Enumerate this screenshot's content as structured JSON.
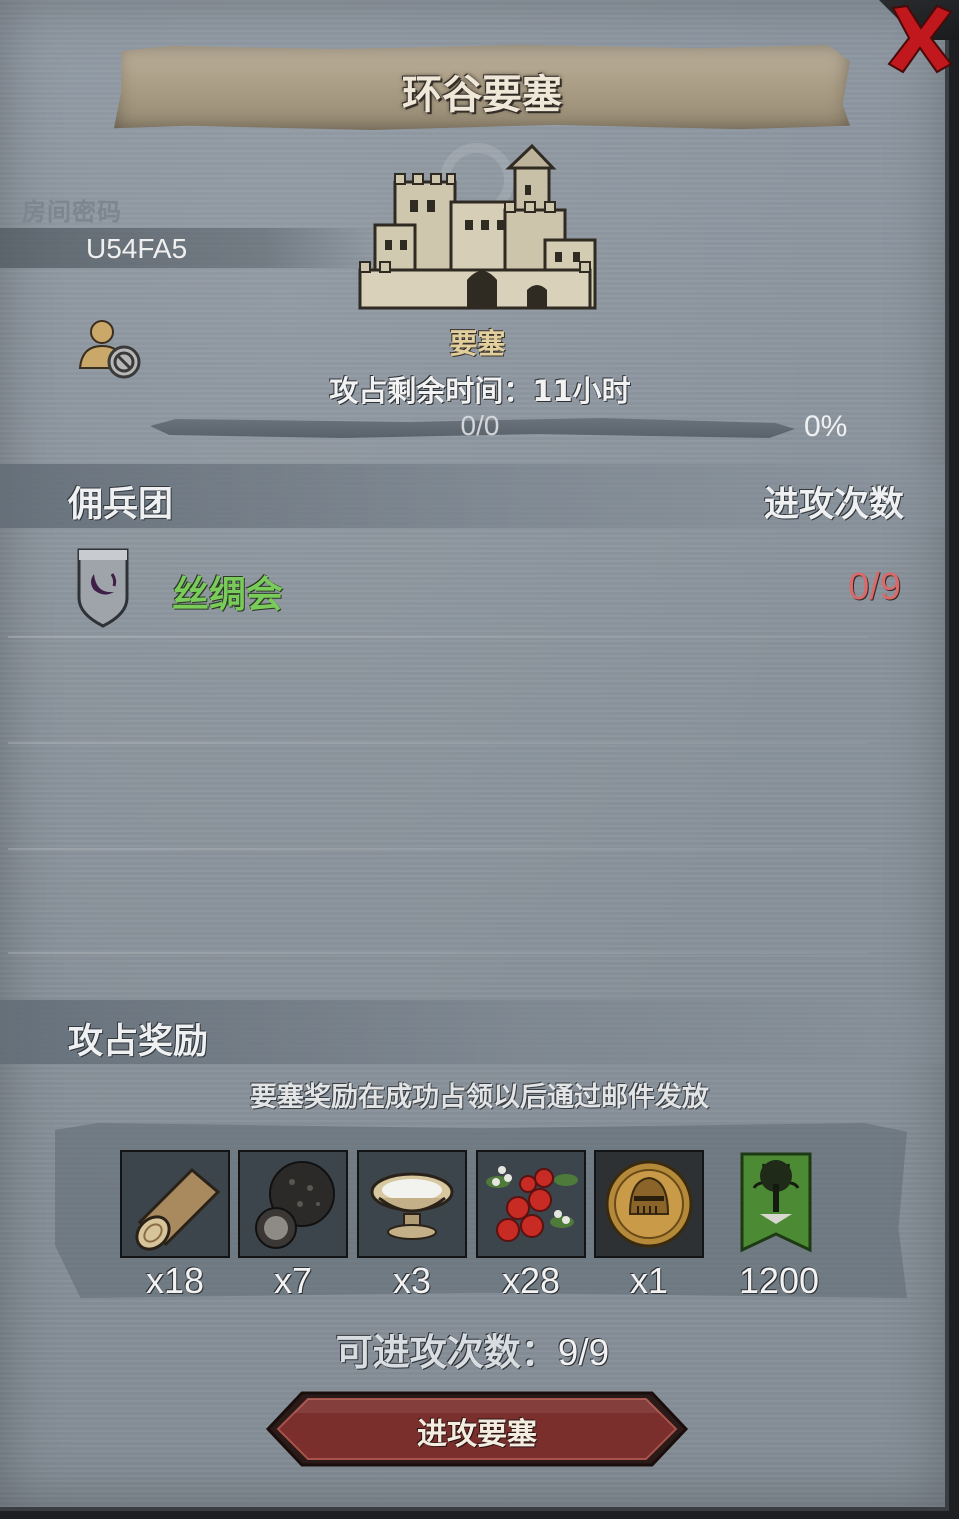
{
  "header": {
    "title": "环谷要塞"
  },
  "room": {
    "label": "房间密码",
    "code": "U54FA5"
  },
  "fortress": {
    "type_label": "要塞",
    "timer_label": "攻占剩余时间：",
    "timer_value": "11小时",
    "progress_text": "0/0",
    "progress_percent": "0%",
    "progress_fraction": 0
  },
  "mercenary_section": {
    "title": "佣兵团",
    "column_attacks": "进攻次数",
    "rows": [
      {
        "name": "丝绸会",
        "attacks": "0/9"
      }
    ]
  },
  "reward_section": {
    "title": "攻占奖励",
    "note": "要塞奖励在成功占领以后通过邮件发放",
    "items": [
      {
        "icon": "wood-log-icon",
        "count": "x18"
      },
      {
        "icon": "truffle-icon",
        "count": "x7"
      },
      {
        "icon": "salt-bowl-icon",
        "count": "x3"
      },
      {
        "icon": "berries-icon",
        "count": "x28"
      },
      {
        "icon": "knight-helmet-coin-icon",
        "count": "x1"
      },
      {
        "icon": "tree-banner-icon",
        "count": "1200"
      }
    ]
  },
  "attempts": {
    "label": "可进攻次数：",
    "value": "9/9"
  },
  "actions": {
    "attack_label": "进攻要塞"
  },
  "colors": {
    "panel": "#8a939c",
    "merc_name": "#7acc5a",
    "attack_count": "#d86a6a",
    "button": "#7a2f2c",
    "close": "#c0181c"
  }
}
